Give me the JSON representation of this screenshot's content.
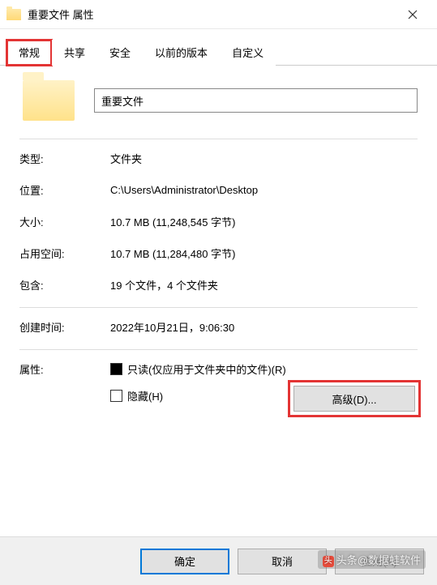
{
  "titlebar": {
    "title": "重要文件 属性"
  },
  "tabs": {
    "items": [
      {
        "label": "常规"
      },
      {
        "label": "共享"
      },
      {
        "label": "安全"
      },
      {
        "label": "以前的版本"
      },
      {
        "label": "自定义"
      }
    ]
  },
  "general": {
    "folder_name": "重要文件",
    "rows": {
      "type_label": "类型:",
      "type_value": "文件夹",
      "location_label": "位置:",
      "location_value": "C:\\Users\\Administrator\\Desktop",
      "size_label": "大小:",
      "size_value": "10.7 MB (11,248,545 字节)",
      "size_on_disk_label": "占用空间:",
      "size_on_disk_value": "10.7 MB (11,284,480 字节)",
      "contains_label": "包含:",
      "contains_value": "19 个文件，4 个文件夹",
      "created_label": "创建时间:",
      "created_value": "2022年10月21日，9:06:30"
    },
    "attributes": {
      "label": "属性:",
      "readonly_label": "只读(仅应用于文件夹中的文件)(R)",
      "hidden_label": "隐藏(H)",
      "advanced_label": "高级(D)..."
    }
  },
  "footer": {
    "ok": "确定",
    "cancel": "取消",
    "apply": "应用(A)"
  },
  "watermark": "头条@数据蛙软件"
}
